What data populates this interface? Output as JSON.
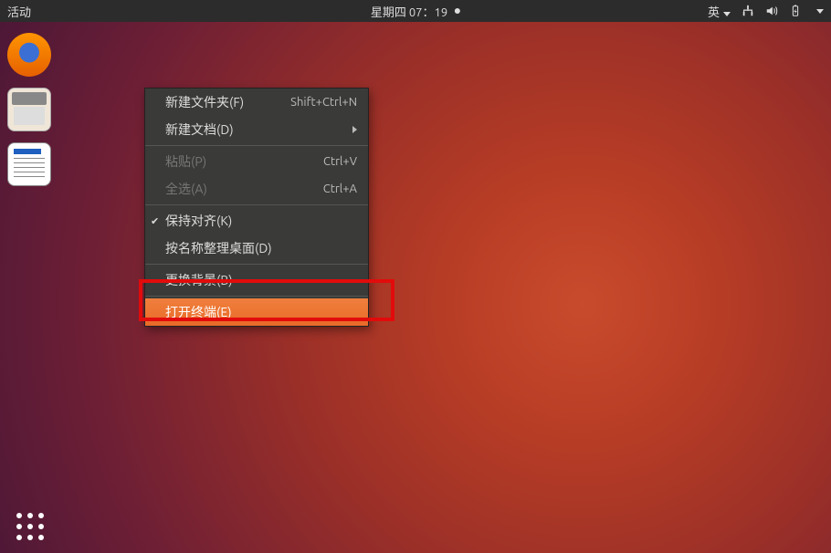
{
  "topbar": {
    "activities": "活动",
    "clock": "星期四 07：19",
    "ime": "英"
  },
  "launcher": {
    "items": [
      {
        "name": "firefox"
      },
      {
        "name": "files"
      },
      {
        "name": "libreoffice-writer"
      }
    ]
  },
  "context_menu": {
    "new_folder": {
      "label": "新建文件夹(F)",
      "accel": "Shift+Ctrl+N"
    },
    "new_document": {
      "label": "新建文档(D)"
    },
    "paste": {
      "label": "粘贴(P)",
      "accel": "Ctrl+V"
    },
    "select_all": {
      "label": "全选(A)",
      "accel": "Ctrl+A"
    },
    "keep_aligned": {
      "label": "保持对齐(K)"
    },
    "organize": {
      "label": "按名称整理桌面(D)"
    },
    "change_bg": {
      "label": "更换背景(B)"
    },
    "open_terminal": {
      "label": "打开终端(E)"
    }
  }
}
